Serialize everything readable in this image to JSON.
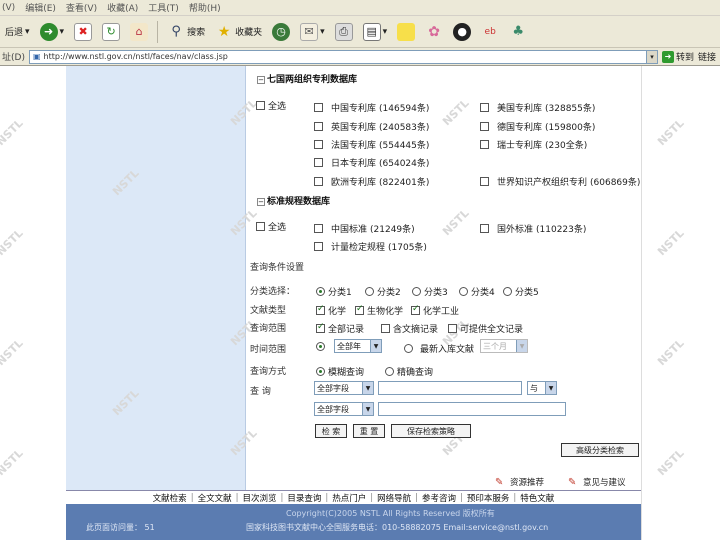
{
  "menubar": {
    "items": [
      "(V)",
      "编辑(E)",
      "查看(V)",
      "收藏(A)",
      "工具(T)",
      "帮助(H)"
    ]
  },
  "toolbar": {
    "back_label": "后退",
    "search_label": "搜索",
    "favorites_label": "收藏夹"
  },
  "addressbar": {
    "label": "址(D)",
    "url": "http://www.nstl.gov.cn/nstl/faces/nav/class.jsp",
    "go_label": "转到",
    "links_label": "链接"
  },
  "watermark_text": "NSTL",
  "patent_section": {
    "title": "七国两组织专利数据库",
    "select_all": "全选",
    "items": [
      {
        "label": "中国专利库",
        "count": "(146594条)",
        "checked": false
      },
      {
        "label": "美国专利库",
        "count": "(328855条)",
        "checked": false
      },
      {
        "label": "英国专利库",
        "count": "(240583条)",
        "checked": false
      },
      {
        "label": "德国专利库",
        "count": "(159800条)",
        "checked": false
      },
      {
        "label": "法国专利库",
        "count": "(554445条)",
        "checked": false
      },
      {
        "label": "瑞士专利库",
        "count": "(230全条)",
        "checked": false
      },
      {
        "label": "日本专利库",
        "count": "(654024条)",
        "checked": false
      },
      {
        "label": "欧洲专利库",
        "count": "(822401条)",
        "checked": false
      },
      {
        "label": "世界知识产权组织专利",
        "count": "(606869条)",
        "checked": false
      }
    ]
  },
  "standard_section": {
    "title": "标准规程数据库",
    "select_all": "全选",
    "items": [
      {
        "label": "中国标准",
        "count": "(21249条)",
        "checked": false
      },
      {
        "label": "国外标准",
        "count": "(110223条)",
        "checked": false
      },
      {
        "label": "计量检定规程",
        "count": "(1705条)",
        "checked": false
      }
    ]
  },
  "query_settings": {
    "heading": "查询条件设置",
    "category_label": "分类选择：",
    "categories": [
      "分类1",
      "分类2",
      "分类3",
      "分类4",
      "分类5"
    ],
    "category_selected": 0,
    "doc_type_label": "文献类型",
    "doc_types": [
      {
        "label": "化学",
        "checked": true
      },
      {
        "label": "生物化学",
        "checked": true
      },
      {
        "label": "化学工业",
        "checked": true
      }
    ],
    "scope_label": "查询范围",
    "scopes": [
      {
        "label": "全部记录",
        "checked": true
      },
      {
        "label": "含文摘记录",
        "checked": false
      },
      {
        "label": "可提供全文记录",
        "checked": false
      }
    ],
    "time_label": "时间范围",
    "time_all_label": "全部年",
    "time_all_value": "全部年",
    "time_recent_label": "最新入库文献",
    "time_recent_value": "三个月",
    "mode_label": "查询方式",
    "modes": [
      "模糊查询",
      "精确查询"
    ],
    "mode_selected": 0,
    "search_label": "查  询",
    "field1_value": "全部字段",
    "logic_value": "与",
    "field2_value": "全部字段"
  },
  "buttons": {
    "search": "检 索",
    "reset": "重 置",
    "save": "保存检索策略",
    "advanced": "高级分类检索"
  },
  "feedback": {
    "recommend": "资源推荐",
    "opinion": "意见与建议"
  },
  "footer": {
    "nav": [
      "文献检索",
      "全文文献",
      "目次浏览",
      "目录查询",
      "热点门户",
      "网络导航",
      "参考咨询",
      "预印本服务",
      "特色文献"
    ],
    "copyright": "Copyright(C)2005 NSTL All Rights Reserved 版权所有",
    "contact": "国家科技图书文献中心全国服务电话：010-58882075 Email:service@nstl.gov.cn",
    "visits_label": "此页面访问量：",
    "visits_value": "51"
  },
  "colors": {
    "nav_bg": "#dce8f7",
    "footer_bg": "#5b7cb1",
    "chrome_bg": "#ece9d8"
  }
}
